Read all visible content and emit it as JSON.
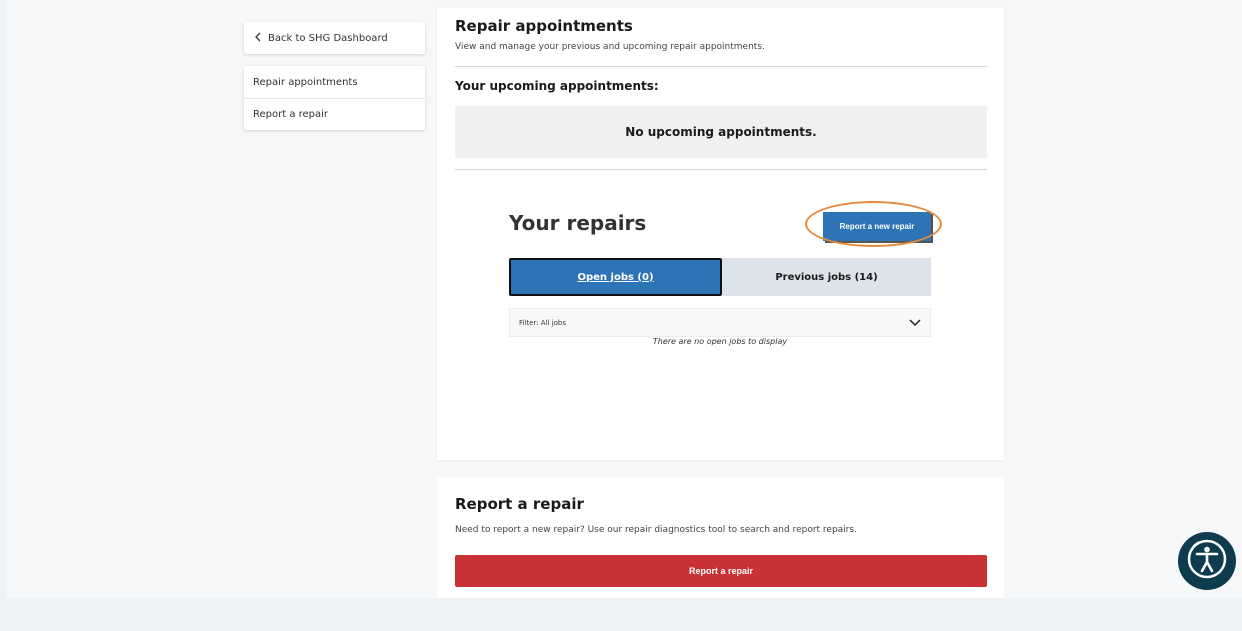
{
  "sidebar": {
    "back_label": "Back to SHG Dashboard",
    "items": [
      {
        "label": "Repair appointments"
      },
      {
        "label": "Report a repair"
      }
    ]
  },
  "appointments": {
    "title": "Repair appointments",
    "subtitle": "View and manage your previous and upcoming repair appointments.",
    "upcoming_heading": "Your upcoming appointments:",
    "empty_message": "No upcoming appointments."
  },
  "repairs": {
    "title": "Your repairs",
    "report_new_label": "Report a new repair",
    "tabs": [
      {
        "label": "Open jobs (0)",
        "active": true
      },
      {
        "label": "Previous jobs (14)",
        "active": false
      }
    ],
    "filter_label": "Filter: All jobs",
    "empty_message": "There are no open jobs to display"
  },
  "report_section": {
    "title": "Report a repair",
    "description": "Need to report a new repair? Use our repair diagnostics tool to search and report repairs.",
    "button_label": "Report a repair"
  },
  "colors": {
    "primary_blue": "#2d74b6",
    "report_red": "#c93234",
    "highlight_orange": "#e68a3c",
    "accessibility_bg": "#0f3b4e"
  },
  "icons": {
    "back": "chevron-left-icon",
    "filter": "chevron-down-icon",
    "accessibility": "accessibility-icon"
  }
}
